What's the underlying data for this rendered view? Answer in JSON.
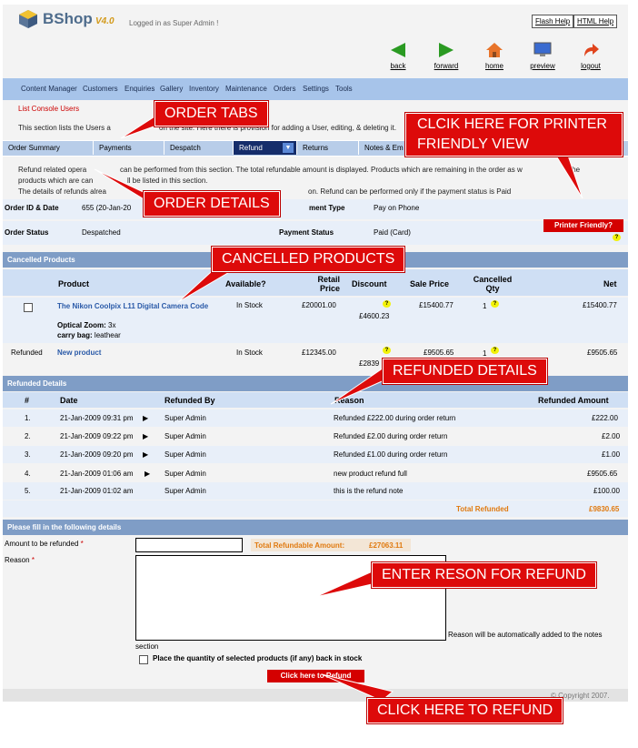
{
  "app": {
    "logo_text": "BShop",
    "version": "V4.0",
    "logged_in": "Logged in as Super Admin !",
    "flash_help": "Flash Help",
    "html_help": "HTML Help"
  },
  "nav_buttons": [
    {
      "label": "back",
      "icon": "back-arrow-icon"
    },
    {
      "label": "forward",
      "icon": "forward-arrow-icon"
    },
    {
      "label": "home",
      "icon": "home-icon"
    },
    {
      "label": "preview",
      "icon": "monitor-icon"
    },
    {
      "label": "logout",
      "icon": "logout-arrow-icon"
    }
  ],
  "menu": [
    "Content Manager",
    "Customers",
    "Enquiries",
    "Gallery",
    "Inventory",
    "Maintenance",
    "Orders",
    "Settings",
    "Tools"
  ],
  "breadcrumb": "List Console Users",
  "section_info": "This section lists the Users a",
  "section_info_2": "on the site. Here there is provision for adding a User, editing, & deleting it.",
  "tabs": [
    "Order Summary",
    "Payments",
    "Despatch",
    "Refund",
    "Returns",
    "Notes & Em"
  ],
  "desc": {
    "line1a": "Refund related opera",
    "line1b": "can be performed from this section. The total refundable amount is displayed. Products which are remaining in the order as w",
    "line1c": "the",
    "line2a": "products which are can",
    "line2b": "ll be listed in this section.",
    "line3a": "The details of refunds alrea",
    "line3b": "on. Refund can be performed only if the payment status is Paid"
  },
  "order": {
    "id_label": "Order ID & Date",
    "id_value": "655  (20-Jan-20",
    "payment_type_label": "ment Type",
    "payment_type_value": "Pay on Phone",
    "status_label": "Order Status",
    "status_value": "Despatched",
    "payment_status_label": "Payment Status",
    "payment_status_value": "Paid (Card)",
    "printer_friendly": "Printer Friendly?"
  },
  "cancelled": {
    "header": "Cancelled Products",
    "columns": [
      "Product",
      "Available?",
      "Retail Price",
      "Discount",
      "Sale Price",
      "Cancelled Qty",
      "Net"
    ],
    "row1": {
      "product": "The Nikon Coolpix L11 Digital Camera Code",
      "optical_zoom_label": "Optical Zoom:",
      "optical_zoom_value": "3x",
      "carry_bag_label": "carry bag:",
      "carry_bag_value": "leathear",
      "available": "In Stock",
      "retail": "£20001.00",
      "discount": "£4600.23",
      "sale": "£15400.77",
      "qty": "1",
      "net": "£15400.77"
    },
    "row2": {
      "status": "Refunded",
      "product": "New product",
      "available": "In Stock",
      "retail": "£12345.00",
      "discount": "£2839",
      "sale": "£9505.65",
      "qty": "1",
      "net": "£9505.65"
    }
  },
  "refunded": {
    "header": "Refunded Details",
    "columns": [
      "#",
      "Date",
      "Refunded By",
      "Reason",
      "Refunded Amount"
    ],
    "rows": [
      {
        "n": "1.",
        "date": "21-Jan-2009 09:31 pm",
        "by": "Super Admin",
        "reason": "Refunded £222.00 during order return",
        "amount": "£222.00"
      },
      {
        "n": "2.",
        "date": "21-Jan-2009 09:22 pm",
        "by": "Super Admin",
        "reason": "Refunded £2.00 during order return",
        "amount": "£2.00"
      },
      {
        "n": "3.",
        "date": "21-Jan-2009 09:20 pm",
        "by": "Super Admin",
        "reason": "Refunded £1.00 during order return",
        "amount": "£1.00"
      },
      {
        "n": "4.",
        "date": "21-Jan-2009 01:06 am",
        "by": "Super Admin",
        "reason": "new product refund full",
        "amount": "£9505.65"
      },
      {
        "n": "5.",
        "date": "21-Jan-2009 01:02 am",
        "by": "Super Admin",
        "reason": "this is the refund note",
        "amount": "£100.00"
      }
    ],
    "total_label": "Total Refunded",
    "total_value": "£9830.65"
  },
  "form": {
    "header": "Please fill in the following details",
    "amount_label": "Amount to be refunded",
    "required": "*",
    "amount_value": "",
    "total_refundable_label": "Total Refundable Amount:",
    "total_refundable_value": "£27063.11",
    "reason_label": "Reason",
    "reason_note": "Reason will be automatically added to the notes",
    "reason_note_2": "section",
    "place_back": "Place the quantity of selected products (if any) back in stock",
    "refund_button": "Click here to Refund"
  },
  "footer": "© Copyright 2007.",
  "callouts": {
    "order_tabs": "ORDER TABS",
    "printer": "CLCIK HERE FOR PRINTER FRIENDLY VIEW",
    "order_details": "ORDER DETAILS",
    "cancelled_products": "CANCELLED PRODUCTS",
    "refunded_details": "REFUNDED DETAILS",
    "enter_reason": "ENTER RESON FOR REFUND",
    "click_refund": "CLICK HERE TO REFUND"
  },
  "colors": {
    "menubar": "#a7c4ea",
    "active_tab": "#152d6b",
    "section_header": "#7f9dc6",
    "callout": "#dd0a0a",
    "total": "#e07a10"
  }
}
